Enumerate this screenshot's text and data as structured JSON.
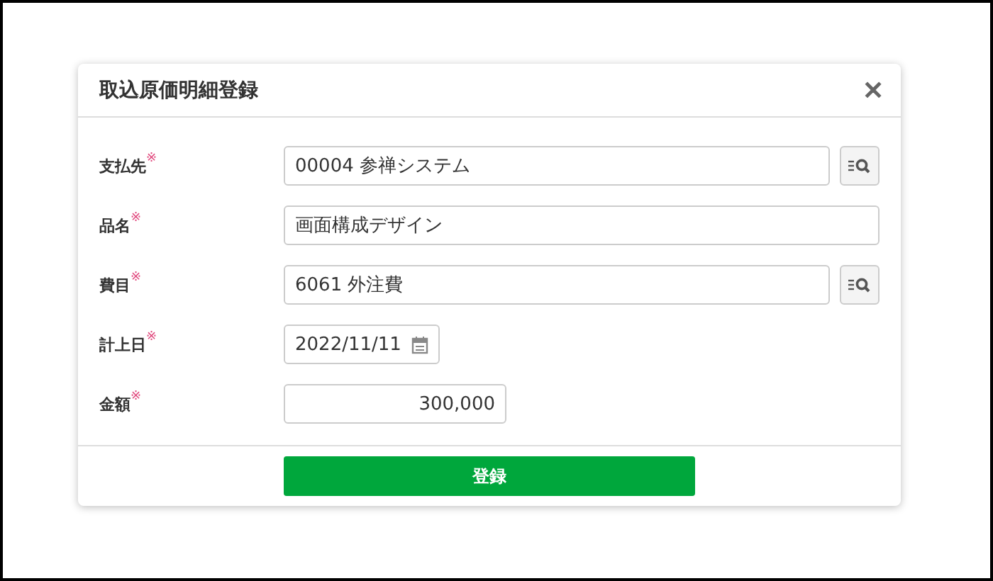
{
  "dialog": {
    "title": "取込原価明細登録",
    "close": "✕"
  },
  "fields": [
    {
      "label": "支払先",
      "required": true,
      "kind": "lookup",
      "value": "00004 参禅システム"
    },
    {
      "label": "品名",
      "required": true,
      "kind": "text",
      "value": "画面構成デザイン"
    },
    {
      "label": "費目",
      "required": true,
      "kind": "lookup",
      "value": "6061 外注費"
    },
    {
      "label": "計上日",
      "required": true,
      "kind": "date",
      "value": "2022/11/11"
    },
    {
      "label": "金額",
      "required": true,
      "kind": "number",
      "value": "300,000"
    }
  ],
  "required_mark": "※",
  "submit": "登録"
}
